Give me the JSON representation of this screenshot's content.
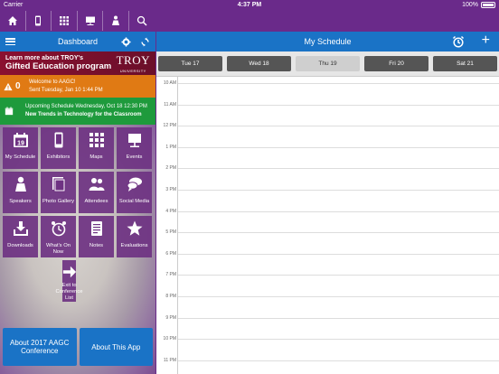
{
  "status": {
    "carrier": "Carrier",
    "time": "4:37 PM",
    "battery": "100%"
  },
  "left_header": {
    "title": "Dashboard"
  },
  "banner": {
    "line1": "Learn more about TROY's",
    "line2": "Gifted Education program",
    "logo": "TROY",
    "logo_sub": "UNIVERSITY"
  },
  "alert": {
    "count": "0",
    "line1": "Welcome to AAGC!",
    "line2": "Sent Tuesday, Jan 10 1:44 PM"
  },
  "upcoming": {
    "line1": "Upcoming Schedule Wednesday, Oct 18 12:30 PM",
    "line2": "New Trends in Technology for the Classroom"
  },
  "tiles": [
    {
      "label": "My Schedule",
      "icon": "calendar-icon"
    },
    {
      "label": "Exhibitors",
      "icon": "phone-icon"
    },
    {
      "label": "Maps",
      "icon": "grid-icon"
    },
    {
      "label": "Events",
      "icon": "easel-icon"
    },
    {
      "label": "Speakers",
      "icon": "speaker-icon"
    },
    {
      "label": "Photo Gallery",
      "icon": "gallery-icon"
    },
    {
      "label": "Attendees",
      "icon": "people-icon"
    },
    {
      "label": "Social Media",
      "icon": "chat-icon"
    },
    {
      "label": "Downloads",
      "icon": "download-icon"
    },
    {
      "label": "What's On Now",
      "icon": "clock-icon"
    },
    {
      "label": "Notes",
      "icon": "notes-icon"
    },
    {
      "label": "Evaluations",
      "icon": "star-icon"
    }
  ],
  "exit_tile": {
    "line1": "Exit to",
    "line2": "Conference List"
  },
  "buttons": {
    "about_conf": "About 2017 AAGC Conference",
    "about_app": "About This App"
  },
  "right_header": {
    "title": "My Schedule"
  },
  "days": [
    "Tue 17",
    "Wed 18",
    "Thu 19",
    "Fri 20",
    "Sat 21"
  ],
  "active_day": "Thu 19",
  "hours": [
    "10 AM",
    "11 AM",
    "12 PM",
    "1 PM",
    "2 PM",
    "3 PM",
    "4 PM",
    "5 PM",
    "6 PM",
    "7 PM",
    "8 PM",
    "9 PM",
    "10 PM",
    "11 PM"
  ]
}
